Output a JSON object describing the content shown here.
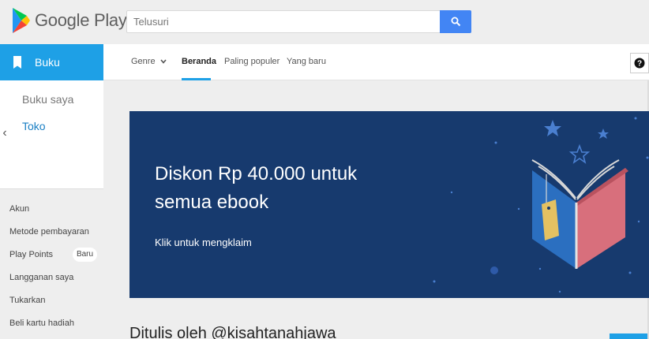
{
  "header": {
    "logo_text": "Google Play",
    "search": {
      "placeholder": "Telusuri"
    }
  },
  "sidebar": {
    "category_label": "Buku",
    "sub_items": [
      {
        "label": "Buku saya"
      },
      {
        "label": "Toko"
      }
    ],
    "account_items": [
      {
        "label": "Akun"
      },
      {
        "label": "Metode pembayaran"
      },
      {
        "label": "Play Points"
      },
      {
        "label": "Langganan saya"
      },
      {
        "label": "Tukarkan"
      },
      {
        "label": "Beli kartu hadiah"
      }
    ],
    "play_points_badge": "Baru"
  },
  "tabs": [
    {
      "label": "Genre"
    },
    {
      "label": "Beranda"
    },
    {
      "label": "Paling populer"
    },
    {
      "label": "Yang baru"
    }
  ],
  "banner": {
    "title": "Diskon Rp 40.000 untuk semua ebook",
    "subtitle": "Klik untuk mengklaim"
  },
  "section": {
    "heading": "Ditulis oleh @kisahtanahjawa"
  },
  "colors": {
    "accent": "#1ea0e6",
    "search_button": "#4285f4",
    "banner_bg": "#173a6e"
  },
  "icons": {
    "logo": "play-logo-icon",
    "search": "search-icon",
    "category": "book-icon",
    "collapse": "chevron-left-icon",
    "genre_dropdown": "chevron-down-icon",
    "help": "help-icon"
  }
}
